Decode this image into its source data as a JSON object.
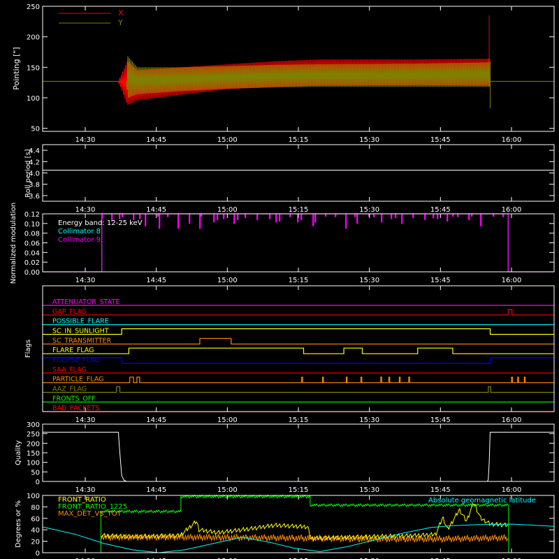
{
  "time_axis": {
    "tick_labels": [
      "14:30",
      "14:45",
      "15:00",
      "15:15",
      "15:30",
      "15:45",
      "16:00"
    ],
    "tick_minutes": [
      870,
      885,
      900,
      915,
      930,
      945,
      960
    ],
    "range_minutes": [
      861,
      969
    ]
  },
  "chart_data": [
    {
      "id": "pointing",
      "type": "line",
      "ylabel": "Pointing [\"]",
      "ylim": [
        45,
        250
      ],
      "yticks": [
        50,
        100,
        150,
        200,
        250
      ],
      "legend": [
        {
          "name": "X",
          "color": "#ff0000"
        },
        {
          "name": "Y",
          "color": "#808000"
        }
      ],
      "reference_line": 127,
      "series": [
        {
          "name": "X",
          "color": "#ff0000",
          "start_minute": 877,
          "end_minute": 955.5,
          "upper_envelope": [
            [
              877,
              127
            ],
            [
              878.9,
              160
            ],
            [
              881,
              145
            ],
            [
              890,
              150
            ],
            [
              900,
              155
            ],
            [
              910,
              160
            ],
            [
              920,
              163
            ],
            [
              940,
              163
            ],
            [
              955,
              164
            ]
          ],
          "lower_envelope": [
            [
              877,
              127
            ],
            [
              878.9,
              88
            ],
            [
              881,
              96
            ],
            [
              890,
              105
            ],
            [
              900,
              114
            ],
            [
              910,
              118
            ],
            [
              920,
              120
            ],
            [
              940,
              121
            ],
            [
              955,
              120
            ]
          ],
          "spike": [
            955.3,
            235
          ]
        },
        {
          "name": "Y",
          "color": "#808000",
          "start_minute": 878.7,
          "end_minute": 955.5,
          "upper_envelope": [
            [
              878.7,
              127
            ],
            [
              879,
              168
            ],
            [
              881,
              150
            ],
            [
              890,
              150
            ],
            [
              900,
              152
            ],
            [
              910,
              154
            ],
            [
              920,
              155
            ],
            [
              940,
              156
            ],
            [
              955,
              158
            ]
          ],
          "lower_envelope": [
            [
              878.7,
              127
            ],
            [
              879,
              100
            ],
            [
              881,
              106
            ],
            [
              890,
              111
            ],
            [
              900,
              115
            ],
            [
              910,
              117
            ],
            [
              920,
              118
            ],
            [
              940,
              118
            ],
            [
              955,
              118
            ]
          ]
        }
      ]
    },
    {
      "id": "roll",
      "type": "line",
      "ylabel": "Roll period [s]",
      "ylim": [
        3.5,
        4.5
      ],
      "yticks": [
        3.6,
        3.8,
        4.0,
        4.2,
        4.4
      ],
      "series": [
        {
          "name": "",
          "color": "#ffffff",
          "points": [
            [
              861,
              4.05
            ],
            [
              969,
              4.05
            ]
          ]
        }
      ]
    },
    {
      "id": "modulation",
      "type": "line",
      "ylabel": "Normalized modulation",
      "ylim": [
        0,
        0.12
      ],
      "yticks": [
        0.0,
        0.02,
        0.04,
        0.06,
        0.08,
        0.1,
        0.12
      ],
      "annotation_lines": [
        {
          "text": "Energy band:  12-25 keV",
          "color": "#ffffff"
        },
        {
          "text": "Collimator 8",
          "color": "#00ffff"
        },
        {
          "text": "Collimator 9",
          "color": "#ff00ff"
        }
      ],
      "series": [
        {
          "name": "Collimator 8",
          "color": "#00ffff",
          "step_start": 873.5,
          "step_end": 959.3,
          "level": 0.12
        },
        {
          "name": "Collimator 9",
          "color": "#ff00ff",
          "start_minute": 873.5,
          "end_minute": 959.3,
          "baseline": 0.12,
          "dips": [
            0.11,
            0.103,
            0.115,
            0.095,
            0.108,
            0.112,
            0.1,
            0.09,
            0.114,
            0.105
          ]
        }
      ]
    },
    {
      "id": "flags",
      "type": "line",
      "ylabel": "Flags",
      "rows": [
        {
          "name": "ATTENUATOR_STATE",
          "color": "#ff00ff",
          "transitions": []
        },
        {
          "name": "GAP_FLAG",
          "color": "#ff0000",
          "transitions": [
            [
              959.3,
              960.1
            ]
          ]
        },
        {
          "name": "POSSIBLE_FLARE",
          "color": "#00ffff",
          "transitions": []
        },
        {
          "name": "SC_IN_SUNLIGHT",
          "color": "#ffff00",
          "transitions": [
            [
              877.7,
              955.5
            ]
          ]
        },
        {
          "name": "SC_TRANSMITTER",
          "color": "#ff8c00",
          "transitions": [
            [
              894.2,
              900.8
            ]
          ]
        },
        {
          "name": "FLARE_FLAG",
          "color": "#ffff00",
          "transitions": [
            [
              879.2,
              916.1
            ],
            [
              924.6,
              928.5
            ],
            [
              940.2,
              947.6
            ]
          ]
        },
        {
          "name": "ECLIPSE_FLAG",
          "color": "#0000ff",
          "transitions": [
            [
              861,
              877.7
            ],
            [
              955.5,
              969
            ]
          ]
        },
        {
          "name": "SAA_FLAG",
          "color": "#ff0000",
          "transitions": []
        },
        {
          "name": "PARTICLE_FLAG",
          "color": "#ff8c00",
          "transitions": [
            [
              879.4,
              880.2
            ],
            [
              880.9,
              881.5
            ],
            [
              915.7,
              915.9
            ],
            [
              920.1,
              920.3
            ],
            [
              925.1,
              925.3
            ],
            [
              928.2,
              928.4
            ],
            [
              932.4,
              932.6
            ],
            [
              934.1,
              934.3
            ],
            [
              936.3,
              936.5
            ],
            [
              938.3,
              938.5
            ],
            [
              960.0,
              960.2
            ],
            [
              961.3,
              961.5
            ],
            [
              962.7,
              962.9
            ]
          ]
        },
        {
          "name": "AAZ_FLAG",
          "color": "#808000",
          "transitions": [
            [
              876.6,
              877.3
            ],
            [
              955.1,
              955.6
            ]
          ]
        },
        {
          "name": "FRONTS_OFF",
          "color": "#00ff00",
          "transitions": []
        },
        {
          "name": "BAD_PACKETS",
          "color": "#ff0000",
          "transitions": []
        }
      ]
    },
    {
      "id": "quality",
      "type": "line",
      "ylabel": "Quality",
      "ylim": [
        0,
        300
      ],
      "yticks": [
        0,
        50,
        100,
        150,
        200,
        250,
        300
      ],
      "series": [
        {
          "name": "",
          "color": "#ffffff",
          "points": [
            [
              861,
              258
            ],
            [
              877.0,
              258
            ],
            [
              877.3,
              150
            ],
            [
              877.7,
              30
            ],
            [
              878.2,
              5
            ],
            [
              878.8,
              0
            ],
            [
              954.9,
              0
            ],
            [
              955.1,
              10
            ],
            [
              955.3,
              100
            ],
            [
              955.5,
              258
            ],
            [
              969,
              258
            ]
          ]
        }
      ]
    },
    {
      "id": "latitude",
      "type": "line",
      "ylabel": "Degrees or %",
      "ylim": [
        0,
        100
      ],
      "yticks": [
        0,
        20,
        40,
        60,
        80,
        100
      ],
      "legend": [
        {
          "name": "FRONT_RATIO",
          "color": "#ffff00"
        },
        {
          "name": "FRONT_RATIO_1225",
          "color": "#00ff00"
        },
        {
          "name": "MAX_DET_VS_TOT",
          "color": "#ff8c00"
        },
        {
          "name": "Absolute geomagnetic latitude",
          "color": "#00ffff"
        }
      ],
      "series": [
        {
          "name": "Absolute geomagnetic latitude",
          "color": "#00ffff",
          "points": [
            [
              861,
              45
            ],
            [
              868,
              32
            ],
            [
              874,
              16
            ],
            [
              880,
              5
            ],
            [
              885.5,
              0
            ],
            [
              891,
              5
            ],
            [
              897,
              16
            ],
            [
              903,
              27
            ],
            [
              909,
              18
            ],
            [
              914,
              8
            ],
            [
              919.5,
              2
            ],
            [
              925,
              10
            ],
            [
              931,
              22
            ],
            [
              937,
              34
            ],
            [
              943,
              44
            ],
            [
              947,
              47
            ],
            [
              953,
              49
            ],
            [
              960,
              50
            ],
            [
              969,
              46
            ]
          ]
        },
        {
          "name": "FRONT_RATIO_1225",
          "color": "#00ff00",
          "step_points": [
            [
              861,
              0
            ],
            [
              873.3,
              0
            ],
            [
              873.3,
              72
            ],
            [
              890.2,
              72
            ],
            [
              890.2,
              98
            ],
            [
              917.5,
              98
            ],
            [
              917.5,
              83
            ],
            [
              959.4,
              83
            ],
            [
              959.4,
              0
            ],
            [
              969,
              0
            ]
          ]
        },
        {
          "name": "FRONT_RATIO",
          "color": "#ffff00",
          "points": [
            [
              873.3,
              30
            ],
            [
              880,
              28
            ],
            [
              890,
              30
            ],
            [
              893.5,
              55
            ],
            [
              894,
              40
            ],
            [
              898,
              35
            ],
            [
              905,
              42
            ],
            [
              910,
              48
            ],
            [
              917,
              45
            ],
            [
              917.5,
              25
            ],
            [
              930,
              28
            ],
            [
              940,
              30
            ],
            [
              944,
              32
            ],
            [
              945.5,
              62
            ],
            [
              946.5,
              40
            ],
            [
              949,
              75
            ],
            [
              950.5,
              55
            ],
            [
              952,
              88
            ],
            [
              953.5,
              60
            ],
            [
              955.5,
              50
            ],
            [
              959.3,
              48
            ]
          ]
        },
        {
          "name": "MAX_DET_VS_TOT",
          "color": "#ff8c00",
          "band": [
            [
              873.3,
              22,
              32
            ],
            [
              890,
              22,
              32
            ],
            [
              910,
              20,
              32
            ],
            [
              930,
              18,
              30
            ],
            [
              945,
              18,
              30
            ],
            [
              959.3,
              20,
              32
            ]
          ]
        }
      ]
    }
  ]
}
